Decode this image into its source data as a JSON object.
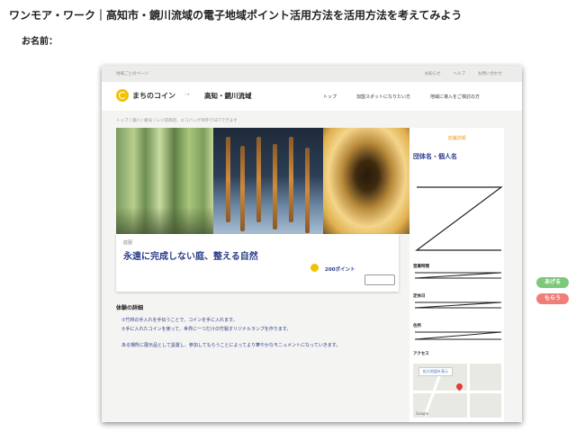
{
  "worksheet": {
    "title": "ワンモア・ワーク｜高知市・鏡川流域の電子地域ポイント活用方法を活用方法を考えてみよう",
    "name_label": "お名前："
  },
  "site": {
    "topbar": {
      "left": "地域ごとのページ",
      "links": [
        "お知らせ",
        "ヘルプ",
        "お問い合わせ"
      ]
    },
    "header": {
      "logo": "まちのコイン",
      "separator": "→",
      "area": "高知・鏡川流域",
      "nav": [
        "トップ",
        "加盟スポットになりたい方",
        "地域に導入をご検討の方"
      ]
    },
    "breadcrumb": "トップ / 鏡川 / 観光 / レジ袋辞退、エコバッグ持参でGETできます",
    "card": {
      "category": "庭園",
      "title": "永遠に完成しない庭、整える自然",
      "points": "200ポイント"
    },
    "detail": {
      "heading": "体験の詳細",
      "lines": [
        "①竹林の手入れを手伝うことで、コインを手に入れます。",
        "②手に入れたコインを使って、世界に一つだけの竹製オリジナルランプを作ります。",
        "ある場所に展示品として設置し、参加してもらうことによってより華やかなモニュメントになっていきます。"
      ]
    },
    "sidebar": {
      "heading": "店舗詳細",
      "org_label": "団体名・個人名",
      "labels": [
        "営業時間",
        "定休日",
        "住所",
        "アクセス"
      ],
      "map_button": "拡大地図を表示",
      "map_credit": "Google"
    }
  },
  "buttons": {
    "ageru": "あげる",
    "morau": "もらう"
  },
  "colors": {
    "accent_blue": "#2a3c8a",
    "coin_yellow": "#f2c200",
    "ageru_green": "#7cc97a",
    "morau_red": "#ef7d78"
  }
}
